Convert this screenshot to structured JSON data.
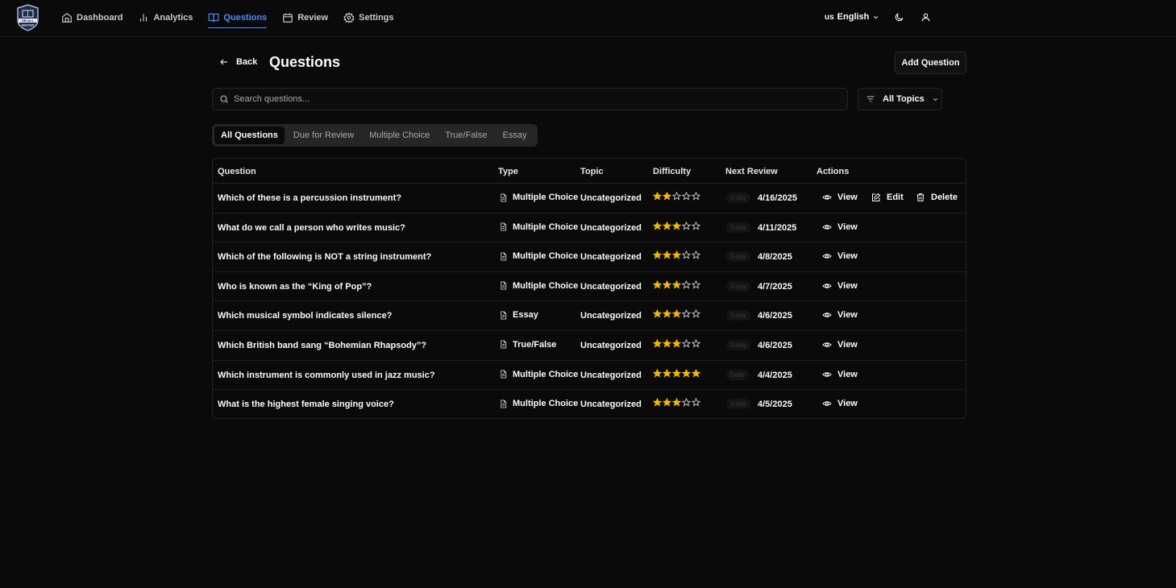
{
  "app": {
    "logo_text": "RECALL MASTER"
  },
  "nav": [
    {
      "label": "Dashboard",
      "icon": "home-icon"
    },
    {
      "label": "Analytics",
      "icon": "bar-chart-icon"
    },
    {
      "label": "Questions",
      "icon": "book-icon",
      "active": true
    },
    {
      "label": "Review",
      "icon": "calendar-icon"
    },
    {
      "label": "Settings",
      "icon": "gear-icon"
    }
  ],
  "language": {
    "flag": "us",
    "label": "English"
  },
  "page": {
    "back_label": "Back",
    "title": "Questions",
    "add_label": "Add Question"
  },
  "search": {
    "placeholder": "Search questions...",
    "value": ""
  },
  "topic_filter": {
    "selected": "All Topics"
  },
  "tabs": [
    "All Questions",
    "Due for Review",
    "Multiple Choice",
    "True/False",
    "Essay"
  ],
  "active_tab": "All Questions",
  "table": {
    "headers": [
      "Question",
      "Type",
      "Topic",
      "Difficulty",
      "Next Review",
      "Actions"
    ],
    "rows": [
      {
        "question": "Which of these is a percussion instrument?",
        "type": "Multiple Choice",
        "topic": "Uncategorized",
        "difficulty": 2,
        "interval": "5-day",
        "next_review": "4/16/2025",
        "actions": [
          "View",
          "Edit",
          "Delete"
        ]
      },
      {
        "question": "What do we call a person who writes music?",
        "type": "Multiple Choice",
        "topic": "Uncategorized",
        "difficulty": 3,
        "interval": "3-day",
        "next_review": "4/11/2025",
        "actions": [
          "View"
        ]
      },
      {
        "question": "Which of the following is NOT a string instrument?",
        "type": "Multiple Choice",
        "topic": "Uncategorized",
        "difficulty": 3,
        "interval": "3-day",
        "next_review": "4/8/2025",
        "actions": [
          "View"
        ]
      },
      {
        "question": "Who is known as the “King of Pop”?",
        "type": "Multiple Choice",
        "topic": "Uncategorized",
        "difficulty": 3,
        "interval": "3-day",
        "next_review": "4/7/2025",
        "actions": [
          "View"
        ]
      },
      {
        "question": "Which musical symbol indicates silence?",
        "type": "Essay",
        "topic": "Uncategorized",
        "difficulty": 3,
        "interval": "3-day",
        "next_review": "4/6/2025",
        "actions": [
          "View"
        ]
      },
      {
        "question": "Which British band sang “Bohemian Rhapsody”?",
        "type": "True/False",
        "topic": "Uncategorized",
        "difficulty": 3,
        "interval": "3-day",
        "next_review": "4/6/2025",
        "actions": [
          "View"
        ]
      },
      {
        "question": "Which instrument is commonly used in jazz music?",
        "type": "Multiple Choice",
        "topic": "Uncategorized",
        "difficulty": 5,
        "interval": "Daily",
        "next_review": "4/4/2025",
        "actions": [
          "View"
        ]
      },
      {
        "question": "What is the highest female singing voice?",
        "type": "Multiple Choice",
        "topic": "Uncategorized",
        "difficulty": 3,
        "interval": "3-day",
        "next_review": "4/5/2025",
        "actions": [
          "View"
        ]
      }
    ]
  },
  "colors": {
    "accent": "#4f8cf7",
    "star": "#f5b800",
    "background": "#0a0a0a"
  }
}
